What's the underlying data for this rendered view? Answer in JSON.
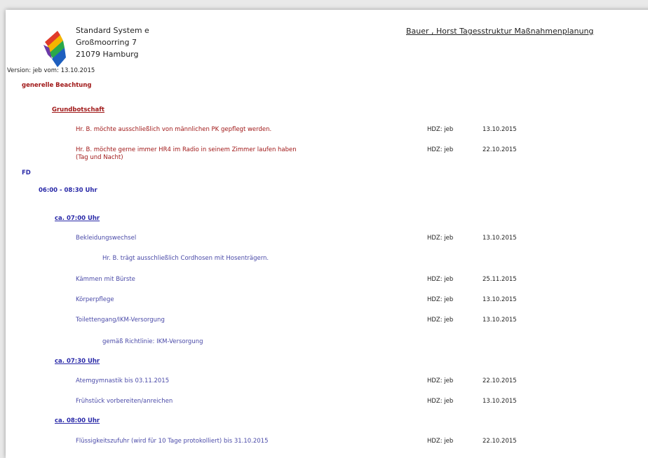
{
  "company": {
    "name": "Standard System e",
    "street": "Großmoorring 7",
    "city": "21079 Hamburg"
  },
  "doc_title": "Bauer , Horst Tagesstruktur Maßnahmenplanung",
  "version": "Version: jeb vom: 13.10.2015",
  "section_general": "generelle Beachtung",
  "grundbotschaft": {
    "title": "Grundbotschaft",
    "rows": [
      {
        "text": "Hr. B. möchte ausschließlich von männlichen PK gepflegt werden.",
        "hdz": "HDZ: jeb",
        "date": "13.10.2015"
      },
      {
        "text1": "Hr. B. möchte gerne immer HR4 im Radio in seinem Zimmer laufen haben",
        "text2": "(Tag und Nacht)",
        "hdz": "HDZ: jeb",
        "date": "22.10.2015"
      }
    ]
  },
  "shift": "FD",
  "group": "06:00 - 08:30 Uhr",
  "slots": [
    {
      "time": "ca. 07:00 Uhr",
      "items": [
        {
          "text": "Bekleidungswechsel",
          "hdz": "HDZ: jeb",
          "date": "13.10.2015"
        },
        {
          "note": "Hr. B. trägt ausschließlich Cordhosen mit Hosenträgern."
        },
        {
          "text": "Kämmen mit Bürste",
          "hdz": "HDZ: jeb",
          "date": "25.11.2015"
        },
        {
          "text": "Körperpflege",
          "hdz": "HDZ: jeb",
          "date": "13.10.2015"
        },
        {
          "text": "Toilettengang/IKM-Versorgung",
          "hdz": "HDZ: jeb",
          "date": "13.10.2015"
        },
        {
          "note": "gemäß Richtlinie: IKM-Versorgung"
        }
      ]
    },
    {
      "time": "ca. 07:30 Uhr",
      "items": [
        {
          "text": "Atemgymnastik bis 03.11.2015",
          "hdz": "HDZ: jeb",
          "date": "22.10.2015"
        },
        {
          "text": "Frühstück vorbereiten/anreichen",
          "hdz": "HDZ: jeb",
          "date": "13.10.2015"
        }
      ]
    },
    {
      "time": "ca. 08:00 Uhr",
      "items": [
        {
          "text": "Flüssigkeitszufuhr (wird für 10 Tage protokolliert) bis 31.10.2015",
          "hdz": "HDZ: jeb",
          "date": "22.10.2015"
        }
      ]
    }
  ]
}
